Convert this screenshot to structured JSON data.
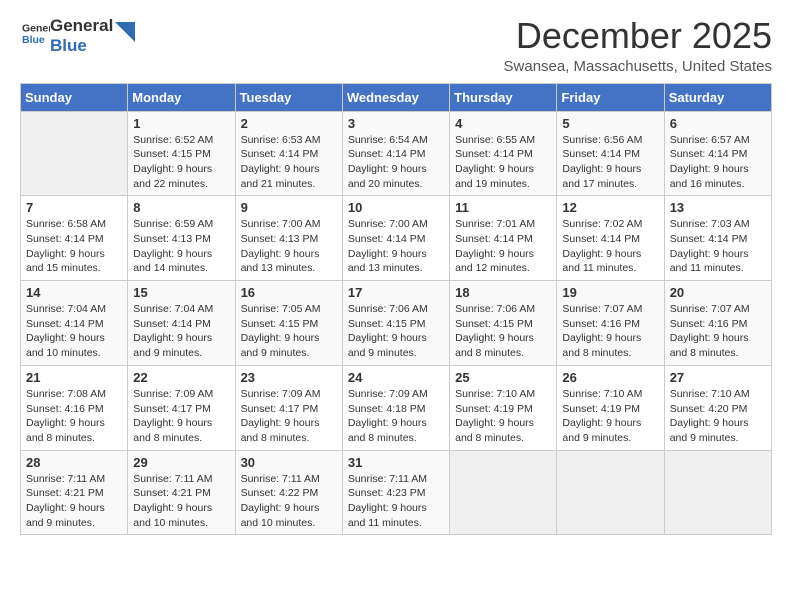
{
  "logo": {
    "line1": "General",
    "line2": "Blue"
  },
  "title": "December 2025",
  "subtitle": "Swansea, Massachusetts, United States",
  "days_of_week": [
    "Sunday",
    "Monday",
    "Tuesday",
    "Wednesday",
    "Thursday",
    "Friday",
    "Saturday"
  ],
  "weeks": [
    [
      {
        "day": "",
        "info": ""
      },
      {
        "day": "1",
        "info": "Sunrise: 6:52 AM\nSunset: 4:15 PM\nDaylight: 9 hours\nand 22 minutes."
      },
      {
        "day": "2",
        "info": "Sunrise: 6:53 AM\nSunset: 4:14 PM\nDaylight: 9 hours\nand 21 minutes."
      },
      {
        "day": "3",
        "info": "Sunrise: 6:54 AM\nSunset: 4:14 PM\nDaylight: 9 hours\nand 20 minutes."
      },
      {
        "day": "4",
        "info": "Sunrise: 6:55 AM\nSunset: 4:14 PM\nDaylight: 9 hours\nand 19 minutes."
      },
      {
        "day": "5",
        "info": "Sunrise: 6:56 AM\nSunset: 4:14 PM\nDaylight: 9 hours\nand 17 minutes."
      },
      {
        "day": "6",
        "info": "Sunrise: 6:57 AM\nSunset: 4:14 PM\nDaylight: 9 hours\nand 16 minutes."
      }
    ],
    [
      {
        "day": "7",
        "info": "Sunrise: 6:58 AM\nSunset: 4:14 PM\nDaylight: 9 hours\nand 15 minutes."
      },
      {
        "day": "8",
        "info": "Sunrise: 6:59 AM\nSunset: 4:13 PM\nDaylight: 9 hours\nand 14 minutes."
      },
      {
        "day": "9",
        "info": "Sunrise: 7:00 AM\nSunset: 4:13 PM\nDaylight: 9 hours\nand 13 minutes."
      },
      {
        "day": "10",
        "info": "Sunrise: 7:00 AM\nSunset: 4:14 PM\nDaylight: 9 hours\nand 13 minutes."
      },
      {
        "day": "11",
        "info": "Sunrise: 7:01 AM\nSunset: 4:14 PM\nDaylight: 9 hours\nand 12 minutes."
      },
      {
        "day": "12",
        "info": "Sunrise: 7:02 AM\nSunset: 4:14 PM\nDaylight: 9 hours\nand 11 minutes."
      },
      {
        "day": "13",
        "info": "Sunrise: 7:03 AM\nSunset: 4:14 PM\nDaylight: 9 hours\nand 11 minutes."
      }
    ],
    [
      {
        "day": "14",
        "info": "Sunrise: 7:04 AM\nSunset: 4:14 PM\nDaylight: 9 hours\nand 10 minutes."
      },
      {
        "day": "15",
        "info": "Sunrise: 7:04 AM\nSunset: 4:14 PM\nDaylight: 9 hours\nand 9 minutes."
      },
      {
        "day": "16",
        "info": "Sunrise: 7:05 AM\nSunset: 4:15 PM\nDaylight: 9 hours\nand 9 minutes."
      },
      {
        "day": "17",
        "info": "Sunrise: 7:06 AM\nSunset: 4:15 PM\nDaylight: 9 hours\nand 9 minutes."
      },
      {
        "day": "18",
        "info": "Sunrise: 7:06 AM\nSunset: 4:15 PM\nDaylight: 9 hours\nand 8 minutes."
      },
      {
        "day": "19",
        "info": "Sunrise: 7:07 AM\nSunset: 4:16 PM\nDaylight: 9 hours\nand 8 minutes."
      },
      {
        "day": "20",
        "info": "Sunrise: 7:07 AM\nSunset: 4:16 PM\nDaylight: 9 hours\nand 8 minutes."
      }
    ],
    [
      {
        "day": "21",
        "info": "Sunrise: 7:08 AM\nSunset: 4:16 PM\nDaylight: 9 hours\nand 8 minutes."
      },
      {
        "day": "22",
        "info": "Sunrise: 7:09 AM\nSunset: 4:17 PM\nDaylight: 9 hours\nand 8 minutes."
      },
      {
        "day": "23",
        "info": "Sunrise: 7:09 AM\nSunset: 4:17 PM\nDaylight: 9 hours\nand 8 minutes."
      },
      {
        "day": "24",
        "info": "Sunrise: 7:09 AM\nSunset: 4:18 PM\nDaylight: 9 hours\nand 8 minutes."
      },
      {
        "day": "25",
        "info": "Sunrise: 7:10 AM\nSunset: 4:19 PM\nDaylight: 9 hours\nand 8 minutes."
      },
      {
        "day": "26",
        "info": "Sunrise: 7:10 AM\nSunset: 4:19 PM\nDaylight: 9 hours\nand 9 minutes."
      },
      {
        "day": "27",
        "info": "Sunrise: 7:10 AM\nSunset: 4:20 PM\nDaylight: 9 hours\nand 9 minutes."
      }
    ],
    [
      {
        "day": "28",
        "info": "Sunrise: 7:11 AM\nSunset: 4:21 PM\nDaylight: 9 hours\nand 9 minutes."
      },
      {
        "day": "29",
        "info": "Sunrise: 7:11 AM\nSunset: 4:21 PM\nDaylight: 9 hours\nand 10 minutes."
      },
      {
        "day": "30",
        "info": "Sunrise: 7:11 AM\nSunset: 4:22 PM\nDaylight: 9 hours\nand 10 minutes."
      },
      {
        "day": "31",
        "info": "Sunrise: 7:11 AM\nSunset: 4:23 PM\nDaylight: 9 hours\nand 11 minutes."
      },
      {
        "day": "",
        "info": ""
      },
      {
        "day": "",
        "info": ""
      },
      {
        "day": "",
        "info": ""
      }
    ]
  ]
}
